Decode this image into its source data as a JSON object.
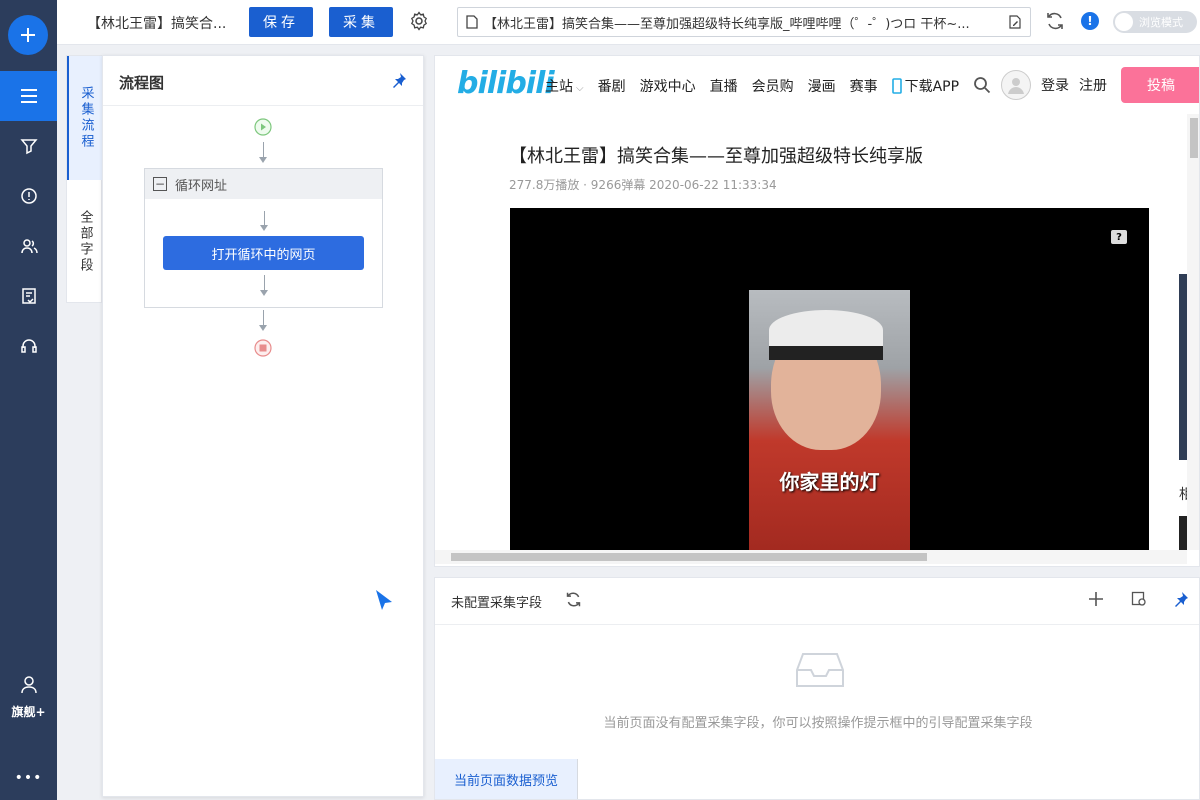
{
  "app": {
    "task_title": "【林北王雷】搞笑合...",
    "save_label": "保存",
    "collect_label": "采集",
    "browse_mode_label": "浏览模式",
    "info_badge": "!"
  },
  "urlbar": {
    "value": "【林北王雷】搞笑合集——至尊加强超级特长纯享版_哔哩哔哩（゜-゜)つロ 干杯~..."
  },
  "leftnav": {
    "user_label": "旗舰+",
    "more_label": "•••"
  },
  "vtabs": {
    "tab1": "采集流程",
    "tab2": "全部字段"
  },
  "flow": {
    "title": "流程图",
    "loop_label": "循环网址",
    "open_page_label": "打开循环中的网页"
  },
  "bili": {
    "logo": "bilibili",
    "nav": [
      "主站",
      "番剧",
      "游戏中心",
      "直播",
      "会员购",
      "漫画",
      "赛事",
      "下载APP"
    ],
    "login": "登录",
    "register": "注册",
    "upload": "投稿",
    "video_title": "【林北王雷】搞笑合集——至尊加强超级特长纯享版",
    "video_meta": "277.8万播放 · 9266弹幕    2020-06-22 11:33:34",
    "video_caption": "你家里的灯",
    "help_badge": "?",
    "side_text": "相"
  },
  "fields": {
    "title": "未配置采集字段",
    "empty_text": "当前页面没有配置采集字段，你可以按照操作提示框中的引导配置采集字段",
    "preview_tab": "当前页面数据预览"
  },
  "colors": {
    "nav_bg": "#2c3d5c",
    "primary": "#1a5fd0",
    "bili_blue": "#23ade5",
    "bili_pink": "#fb7299"
  }
}
